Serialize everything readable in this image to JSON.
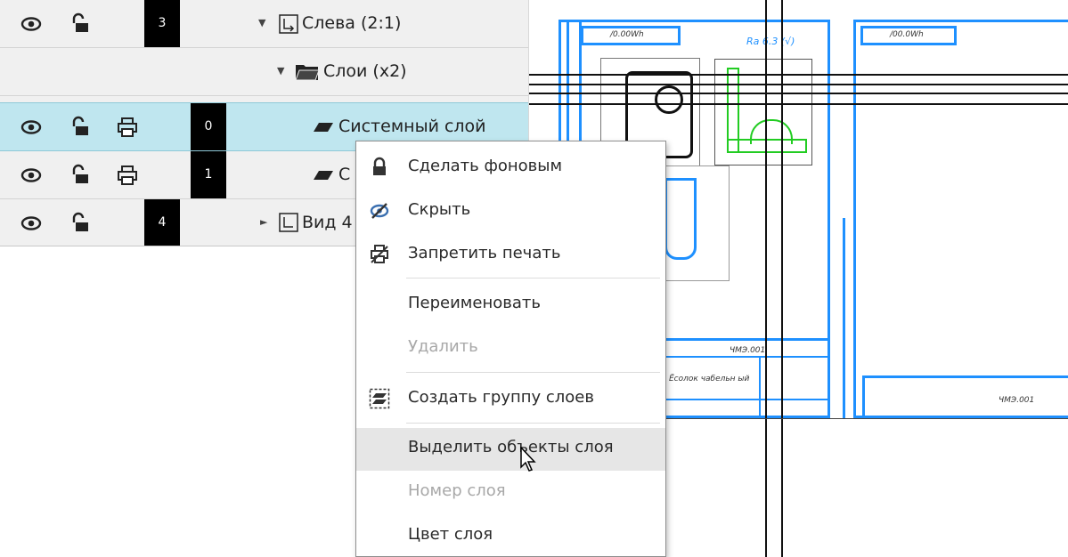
{
  "layers_panel": {
    "rows": [
      {
        "number": "3",
        "label": "Слева (2:1)"
      },
      {
        "label": "Слои (x2)"
      },
      {
        "number": "0",
        "label": "Системный слой"
      },
      {
        "number": "1",
        "label": "С"
      },
      {
        "number": "4",
        "label": "Вид 4"
      }
    ]
  },
  "drawing": {
    "sheet1_text": "/0.00Wh",
    "sheet2_text": "/00.0Wh",
    "roughness": "Ra 6.3 (√)",
    "title_code": "ЧМЭ.001",
    "title_name": "Ёсолок чабельн ый",
    "sheet2_code": "ЧМЭ.001"
  },
  "context_menu": {
    "items": [
      {
        "label": "Сделать фоновым",
        "icon": "lock-icon",
        "disabled": false
      },
      {
        "label": "Скрыть",
        "icon": "hide-eye-icon",
        "disabled": false
      },
      {
        "label": "Запретить печать",
        "icon": "no-print-icon",
        "disabled": false
      },
      {
        "label": "Переименовать",
        "disabled": false
      },
      {
        "label": "Удалить",
        "disabled": true
      },
      {
        "label": "Создать группу слоев",
        "icon": "layer-group-icon",
        "disabled": false
      },
      {
        "label": "Выделить объекты слоя",
        "disabled": false,
        "hovered": true
      },
      {
        "label": "Номер слоя",
        "disabled": true
      },
      {
        "label": "Цвет слоя",
        "disabled": false
      }
    ]
  },
  "colors": {
    "selection": "#bfe6ef",
    "drawing_blue": "#1e90ff",
    "drawing_green": "#22cc22"
  }
}
